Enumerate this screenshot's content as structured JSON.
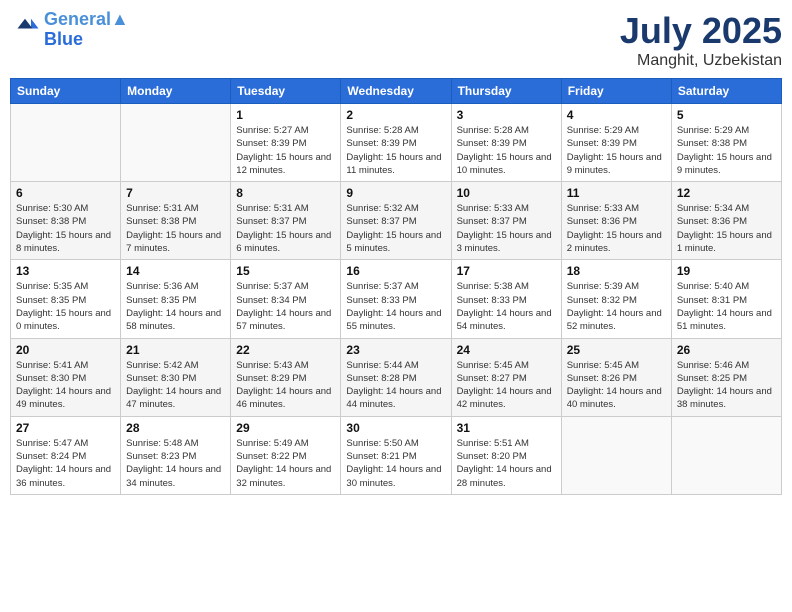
{
  "header": {
    "logo_line1": "General",
    "logo_line2": "Blue",
    "month": "July 2025",
    "location": "Manghit, Uzbekistan"
  },
  "weekdays": [
    "Sunday",
    "Monday",
    "Tuesday",
    "Wednesday",
    "Thursday",
    "Friday",
    "Saturday"
  ],
  "weeks": [
    [
      {
        "day": "",
        "sunrise": "",
        "sunset": "",
        "daylight": ""
      },
      {
        "day": "",
        "sunrise": "",
        "sunset": "",
        "daylight": ""
      },
      {
        "day": "1",
        "sunrise": "Sunrise: 5:27 AM",
        "sunset": "Sunset: 8:39 PM",
        "daylight": "Daylight: 15 hours and 12 minutes."
      },
      {
        "day": "2",
        "sunrise": "Sunrise: 5:28 AM",
        "sunset": "Sunset: 8:39 PM",
        "daylight": "Daylight: 15 hours and 11 minutes."
      },
      {
        "day": "3",
        "sunrise": "Sunrise: 5:28 AM",
        "sunset": "Sunset: 8:39 PM",
        "daylight": "Daylight: 15 hours and 10 minutes."
      },
      {
        "day": "4",
        "sunrise": "Sunrise: 5:29 AM",
        "sunset": "Sunset: 8:39 PM",
        "daylight": "Daylight: 15 hours and 9 minutes."
      },
      {
        "day": "5",
        "sunrise": "Sunrise: 5:29 AM",
        "sunset": "Sunset: 8:38 PM",
        "daylight": "Daylight: 15 hours and 9 minutes."
      }
    ],
    [
      {
        "day": "6",
        "sunrise": "Sunrise: 5:30 AM",
        "sunset": "Sunset: 8:38 PM",
        "daylight": "Daylight: 15 hours and 8 minutes."
      },
      {
        "day": "7",
        "sunrise": "Sunrise: 5:31 AM",
        "sunset": "Sunset: 8:38 PM",
        "daylight": "Daylight: 15 hours and 7 minutes."
      },
      {
        "day": "8",
        "sunrise": "Sunrise: 5:31 AM",
        "sunset": "Sunset: 8:37 PM",
        "daylight": "Daylight: 15 hours and 6 minutes."
      },
      {
        "day": "9",
        "sunrise": "Sunrise: 5:32 AM",
        "sunset": "Sunset: 8:37 PM",
        "daylight": "Daylight: 15 hours and 5 minutes."
      },
      {
        "day": "10",
        "sunrise": "Sunrise: 5:33 AM",
        "sunset": "Sunset: 8:37 PM",
        "daylight": "Daylight: 15 hours and 3 minutes."
      },
      {
        "day": "11",
        "sunrise": "Sunrise: 5:33 AM",
        "sunset": "Sunset: 8:36 PM",
        "daylight": "Daylight: 15 hours and 2 minutes."
      },
      {
        "day": "12",
        "sunrise": "Sunrise: 5:34 AM",
        "sunset": "Sunset: 8:36 PM",
        "daylight": "Daylight: 15 hours and 1 minute."
      }
    ],
    [
      {
        "day": "13",
        "sunrise": "Sunrise: 5:35 AM",
        "sunset": "Sunset: 8:35 PM",
        "daylight": "Daylight: 15 hours and 0 minutes."
      },
      {
        "day": "14",
        "sunrise": "Sunrise: 5:36 AM",
        "sunset": "Sunset: 8:35 PM",
        "daylight": "Daylight: 14 hours and 58 minutes."
      },
      {
        "day": "15",
        "sunrise": "Sunrise: 5:37 AM",
        "sunset": "Sunset: 8:34 PM",
        "daylight": "Daylight: 14 hours and 57 minutes."
      },
      {
        "day": "16",
        "sunrise": "Sunrise: 5:37 AM",
        "sunset": "Sunset: 8:33 PM",
        "daylight": "Daylight: 14 hours and 55 minutes."
      },
      {
        "day": "17",
        "sunrise": "Sunrise: 5:38 AM",
        "sunset": "Sunset: 8:33 PM",
        "daylight": "Daylight: 14 hours and 54 minutes."
      },
      {
        "day": "18",
        "sunrise": "Sunrise: 5:39 AM",
        "sunset": "Sunset: 8:32 PM",
        "daylight": "Daylight: 14 hours and 52 minutes."
      },
      {
        "day": "19",
        "sunrise": "Sunrise: 5:40 AM",
        "sunset": "Sunset: 8:31 PM",
        "daylight": "Daylight: 14 hours and 51 minutes."
      }
    ],
    [
      {
        "day": "20",
        "sunrise": "Sunrise: 5:41 AM",
        "sunset": "Sunset: 8:30 PM",
        "daylight": "Daylight: 14 hours and 49 minutes."
      },
      {
        "day": "21",
        "sunrise": "Sunrise: 5:42 AM",
        "sunset": "Sunset: 8:30 PM",
        "daylight": "Daylight: 14 hours and 47 minutes."
      },
      {
        "day": "22",
        "sunrise": "Sunrise: 5:43 AM",
        "sunset": "Sunset: 8:29 PM",
        "daylight": "Daylight: 14 hours and 46 minutes."
      },
      {
        "day": "23",
        "sunrise": "Sunrise: 5:44 AM",
        "sunset": "Sunset: 8:28 PM",
        "daylight": "Daylight: 14 hours and 44 minutes."
      },
      {
        "day": "24",
        "sunrise": "Sunrise: 5:45 AM",
        "sunset": "Sunset: 8:27 PM",
        "daylight": "Daylight: 14 hours and 42 minutes."
      },
      {
        "day": "25",
        "sunrise": "Sunrise: 5:45 AM",
        "sunset": "Sunset: 8:26 PM",
        "daylight": "Daylight: 14 hours and 40 minutes."
      },
      {
        "day": "26",
        "sunrise": "Sunrise: 5:46 AM",
        "sunset": "Sunset: 8:25 PM",
        "daylight": "Daylight: 14 hours and 38 minutes."
      }
    ],
    [
      {
        "day": "27",
        "sunrise": "Sunrise: 5:47 AM",
        "sunset": "Sunset: 8:24 PM",
        "daylight": "Daylight: 14 hours and 36 minutes."
      },
      {
        "day": "28",
        "sunrise": "Sunrise: 5:48 AM",
        "sunset": "Sunset: 8:23 PM",
        "daylight": "Daylight: 14 hours and 34 minutes."
      },
      {
        "day": "29",
        "sunrise": "Sunrise: 5:49 AM",
        "sunset": "Sunset: 8:22 PM",
        "daylight": "Daylight: 14 hours and 32 minutes."
      },
      {
        "day": "30",
        "sunrise": "Sunrise: 5:50 AM",
        "sunset": "Sunset: 8:21 PM",
        "daylight": "Daylight: 14 hours and 30 minutes."
      },
      {
        "day": "31",
        "sunrise": "Sunrise: 5:51 AM",
        "sunset": "Sunset: 8:20 PM",
        "daylight": "Daylight: 14 hours and 28 minutes."
      },
      {
        "day": "",
        "sunrise": "",
        "sunset": "",
        "daylight": ""
      },
      {
        "day": "",
        "sunrise": "",
        "sunset": "",
        "daylight": ""
      }
    ]
  ]
}
